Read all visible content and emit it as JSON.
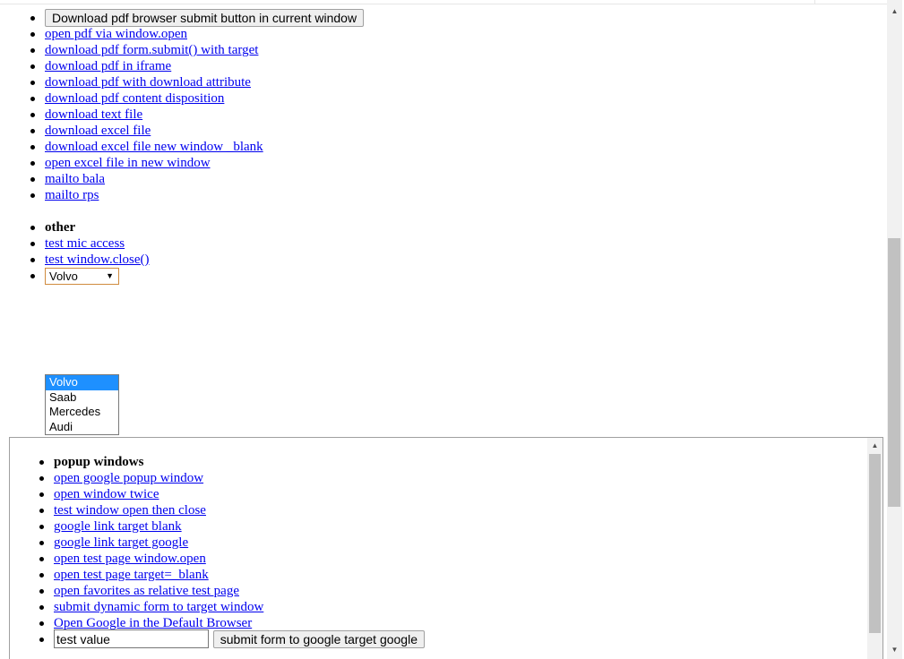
{
  "top_partial_button": "Download pdf browser submit button in current window",
  "main": {
    "downloads": [
      "open pdf via window.open",
      "download pdf form.submit() with target",
      "download pdf in iframe",
      "download pdf with download attribute",
      "download pdf content disposition",
      "download text file",
      "download excel file",
      "download excel file new window _blank",
      "open excel file in new window",
      "mailto bala",
      "mailto rps"
    ],
    "other_heading": "other",
    "other_links": [
      "test mic access",
      "test window.close()"
    ],
    "select": {
      "value": "Volvo",
      "options": [
        "Volvo",
        "Saab",
        "Mercedes",
        "Audi"
      ]
    }
  },
  "frame": {
    "heading": "popup windows",
    "links": [
      "open google popup window",
      "open window twice",
      "test window open then close",
      "google link target blank",
      "google link target google",
      "open test page window.open",
      "open test page target=_blank",
      "open favorites as relative test page",
      "submit dynamic form to target window",
      "Open Google in the Default Browser"
    ],
    "input_value": "test value",
    "submit_label": "submit form to google target google"
  },
  "icons": {
    "scroll_up": "scroll-up-arrow-icon",
    "scroll_down": "scroll-down-arrow-icon",
    "dropdown": "chevron-down-icon"
  }
}
